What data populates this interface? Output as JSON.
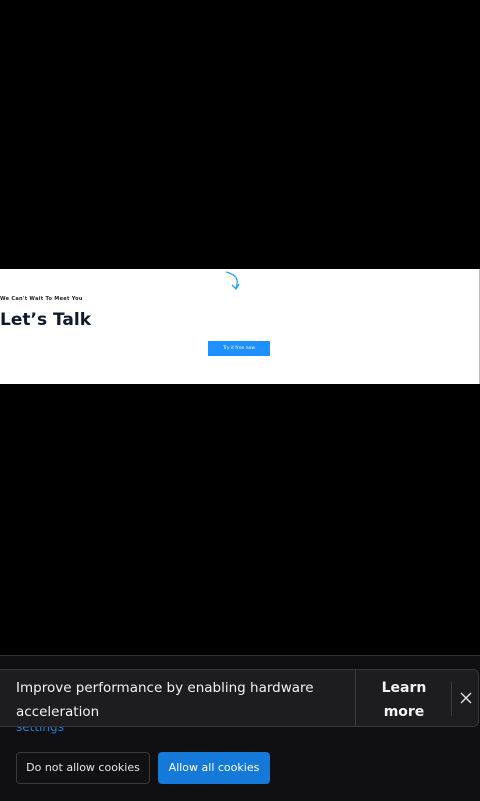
{
  "banner": {
    "tagline": "We Can't Wait To Meet You",
    "headline": "Let’s Talk",
    "cta_label": "Try it free now"
  },
  "cookies": {
    "settings_link": "settings",
    "deny_label": "Do not allow cookies",
    "allow_label": "Allow all cookies"
  },
  "toast": {
    "message": "Improve performance by enabling hardware acceleration",
    "learn_more": "Learn more",
    "close_icon": "close-icon"
  },
  "colors": {
    "background": "#000000",
    "accent": "#1479d9",
    "toast_bg": "#1d1d1f"
  }
}
